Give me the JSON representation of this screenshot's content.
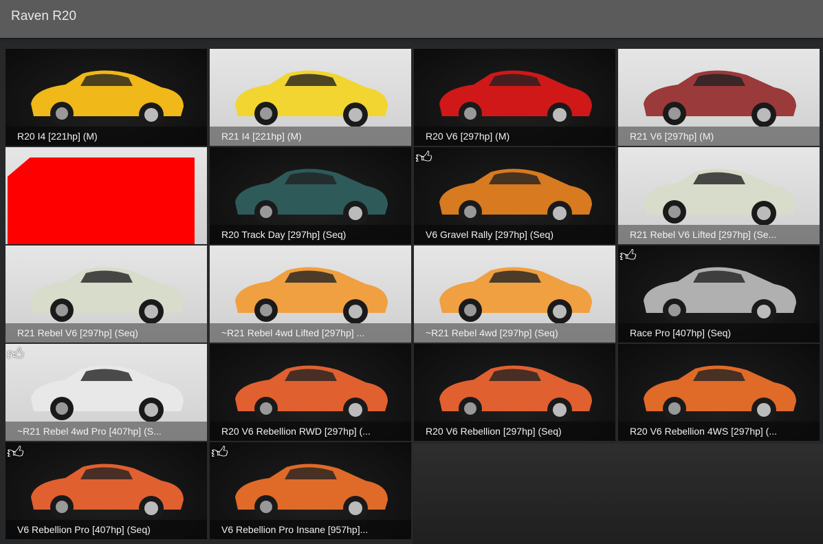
{
  "header": {
    "title": "Raven R20"
  },
  "tiles": [
    {
      "label": "R20 I4 [221hp] (M)",
      "bg": "dark",
      "color": "#f0b818",
      "fav": false
    },
    {
      "label": "R21 I4 [221hp] (M)",
      "bg": "light",
      "color": "#f2d530",
      "fav": false
    },
    {
      "label": "R20 V6 [297hp] (M)",
      "bg": "dark",
      "color": "#d01818",
      "fav": false
    },
    {
      "label": "R21 V6 [297hp] (M)",
      "bg": "light",
      "color": "#9a3a3a",
      "fav": false
    },
    {
      "label": "",
      "bg": "light",
      "color": "#ff0000",
      "fav": false,
      "placeholder": true
    },
    {
      "label": "R20 Track Day [297hp] (Seq)",
      "bg": "dark",
      "color": "#2e5a5a",
      "fav": false
    },
    {
      "label": "V6 Gravel Rally [297hp] (Seq)",
      "bg": "dark",
      "color": "#d87a20",
      "fav": true
    },
    {
      "label": "R21 Rebel V6 Lifted [297hp] (Se...",
      "bg": "light",
      "color": "#d8dccb",
      "fav": false
    },
    {
      "label": "R21 Rebel V6 [297hp] (Seq)",
      "bg": "light",
      "color": "#d8dccb",
      "fav": false
    },
    {
      "label": "~R21 Rebel 4wd Lifted [297hp] ...",
      "bg": "light",
      "color": "#f0a040",
      "fav": false
    },
    {
      "label": "~R21 Rebel 4wd [297hp] (Seq)",
      "bg": "light",
      "color": "#f0a040",
      "fav": false
    },
    {
      "label": "Race Pro [407hp] (Seq)",
      "bg": "dark",
      "color": "#b0b0b0",
      "fav": true
    },
    {
      "label": "~R21 Rebel 4wd Pro [407hp] (S...",
      "bg": "light",
      "color": "#e8e8e8",
      "fav": true
    },
    {
      "label": "R20 V6 Rebellion RWD [297hp] (...",
      "bg": "dark",
      "color": "#e06030",
      "fav": false
    },
    {
      "label": "R20 V6 Rebellion [297hp] (Seq)",
      "bg": "dark",
      "color": "#e06030",
      "fav": false
    },
    {
      "label": "R20 V6 Rebellion 4WS [297hp] (...",
      "bg": "dark",
      "color": "#e06a28",
      "fav": false
    },
    {
      "label": "V6 Rebellion Pro [407hp] (Seq)",
      "bg": "dark",
      "color": "#e06030",
      "fav": true
    },
    {
      "label": "V6 Rebellion Pro Insane [957hp]...",
      "bg": "dark",
      "color": "#e06a28",
      "fav": true
    }
  ]
}
